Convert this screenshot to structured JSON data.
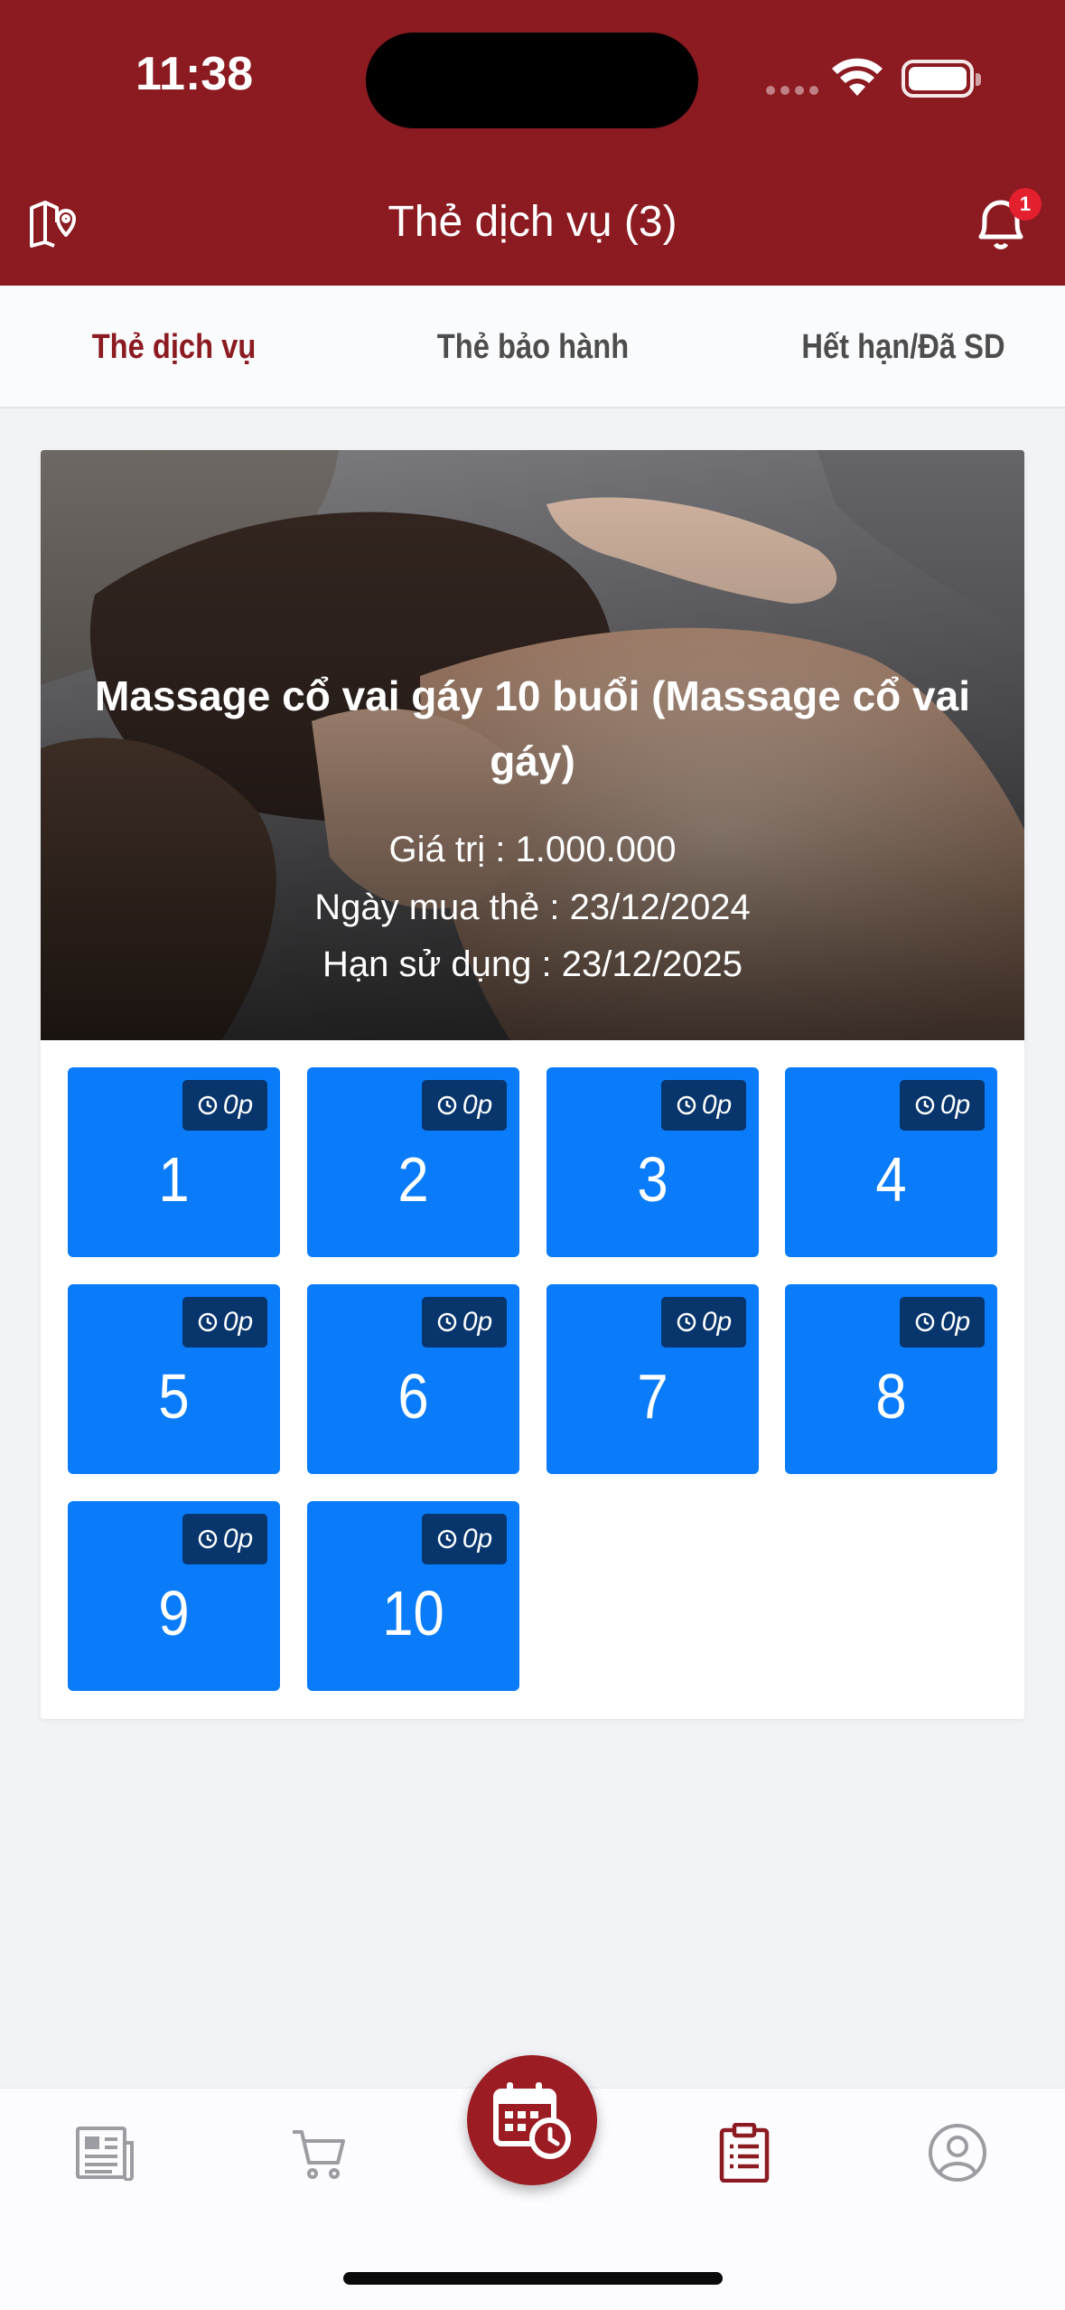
{
  "status_bar": {
    "time": "11:38"
  },
  "header": {
    "title": "Thẻ dịch vụ (3)",
    "notification_count": "1"
  },
  "tabs": [
    {
      "label": "Thẻ dịch vụ",
      "active": true
    },
    {
      "label": "Thẻ bảo hành",
      "active": false
    },
    {
      "label": "Hết hạn/Đã SD",
      "active": false
    }
  ],
  "card": {
    "title": "Massage cổ vai gáy 10 buổi (Massage cổ vai gáy)",
    "value_line": "Giá trị : 1.000.000",
    "purchase_line": "Ngày mua thẻ : 23/12/2024",
    "expiry_line": "Hạn sử dụng : 23/12/2025",
    "sessions": [
      {
        "number": "1",
        "duration": "0p"
      },
      {
        "number": "2",
        "duration": "0p"
      },
      {
        "number": "3",
        "duration": "0p"
      },
      {
        "number": "4",
        "duration": "0p"
      },
      {
        "number": "5",
        "duration": "0p"
      },
      {
        "number": "6",
        "duration": "0p"
      },
      {
        "number": "7",
        "duration": "0p"
      },
      {
        "number": "8",
        "duration": "0p"
      },
      {
        "number": "9",
        "duration": "0p"
      },
      {
        "number": "10",
        "duration": "0p"
      }
    ]
  },
  "bottom_nav": [
    {
      "icon": "news-icon",
      "active": false
    },
    {
      "icon": "cart-icon",
      "active": false
    },
    {
      "icon": "calendar-clock-icon",
      "active": false
    },
    {
      "icon": "clipboard-icon",
      "active": true
    },
    {
      "icon": "user-icon",
      "active": false
    }
  ],
  "colors": {
    "brand": "#8b1a21",
    "session_tile": "#0a7cfa",
    "session_tag": "#07356c"
  }
}
